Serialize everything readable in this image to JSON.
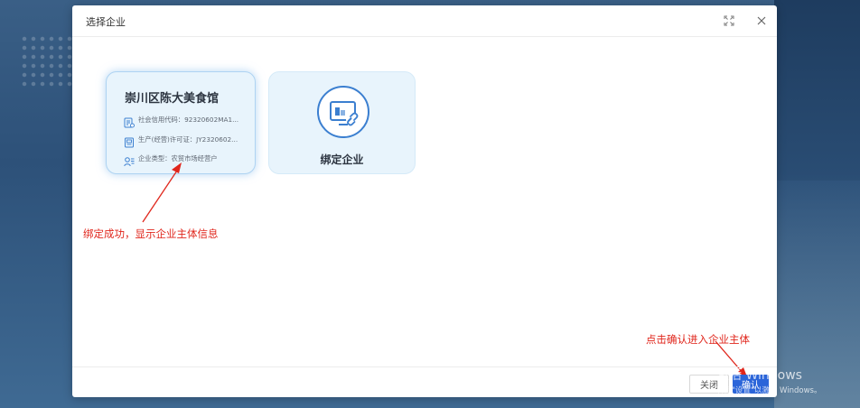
{
  "dialog": {
    "title": "选择企业"
  },
  "company_card": {
    "name": "崇川区陈大美食馆",
    "credit_code": "社会信用代码：92320602MA1...",
    "license": "生产(经营)许可证：JY2320602...",
    "type": "企业类型：农贸市场经营户"
  },
  "bind_card": {
    "label": "绑定企业"
  },
  "annotations": {
    "bind_success": "绑定成功，显示企业主体信息",
    "confirm_hint": "点击确认进入企业主体"
  },
  "footer": {
    "close_label": "关闭",
    "confirm_label": "确认"
  },
  "watermark": {
    "line1": "激活 Windows",
    "line2": "转到\"设置\"以激活 Windows。"
  },
  "colors": {
    "accent": "#2b65d9",
    "annotation": "#e0261c",
    "card_bg": "#e8f4fc",
    "icon_blue": "#3b7fd0"
  },
  "icons": [
    "expand-icon",
    "close-icon",
    "credit-code-icon",
    "license-icon",
    "enterprise-type-icon",
    "bind-enterprise-icon"
  ]
}
